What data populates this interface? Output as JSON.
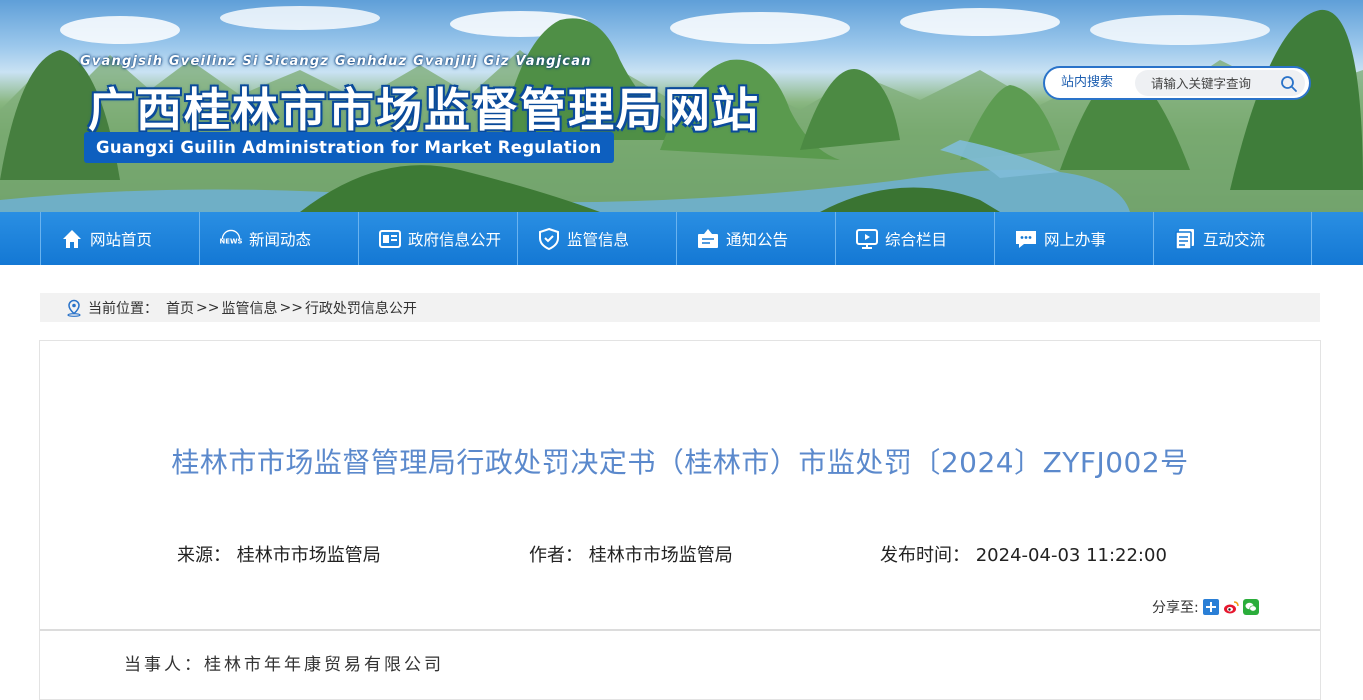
{
  "header": {
    "site_pinyin": "Gvangjsih Gveilinz Si Sicangz Genhduz Gvanjlij Giz Vangjcan",
    "site_title": "广西桂林市市场监督管理局网站",
    "site_title_en": "Guangxi Guilin Administration for Market Regulation",
    "search": {
      "label": "站内搜索",
      "placeholder": "请输入关键字查询",
      "button_icon": "search-icon"
    }
  },
  "nav": {
    "items": [
      {
        "label": "网站首页",
        "icon": "home-icon"
      },
      {
        "label": "新闻动态",
        "icon": "news-icon"
      },
      {
        "label": "政府信息公开",
        "icon": "info-panel-icon"
      },
      {
        "label": "监管信息",
        "icon": "shield-icon"
      },
      {
        "label": "通知公告",
        "icon": "notice-icon"
      },
      {
        "label": "综合栏目",
        "icon": "monitor-icon"
      },
      {
        "label": "网上办事",
        "icon": "chat-icon"
      },
      {
        "label": "互动交流",
        "icon": "document-icon"
      }
    ]
  },
  "breadcrumb": {
    "prefix": "当前位置：",
    "items": [
      "首页",
      "监管信息",
      "行政处罚信息公开"
    ],
    "separator": ">>"
  },
  "article": {
    "title": "桂林市市场监督管理局行政处罚决定书（桂林市）市监处罚〔2024〕ZYFJ002号",
    "source_label": "来源：",
    "source_value": "桂林市市场监管局",
    "author_label": "作者：",
    "author_value": "桂林市市场监管局",
    "time_label": "发布时间：",
    "time_value": "2024-04-03 11:22:00",
    "share_label": "分享至:",
    "share_icons": [
      "qzone-icon",
      "weibo-icon",
      "wechat-icon"
    ],
    "party_text": "当事人：桂林市年年康贸易有限公司"
  },
  "colors": {
    "nav_bg": "#1478d4",
    "title_blue": "#5b89cc",
    "en_badge": "#0d5fbf"
  }
}
